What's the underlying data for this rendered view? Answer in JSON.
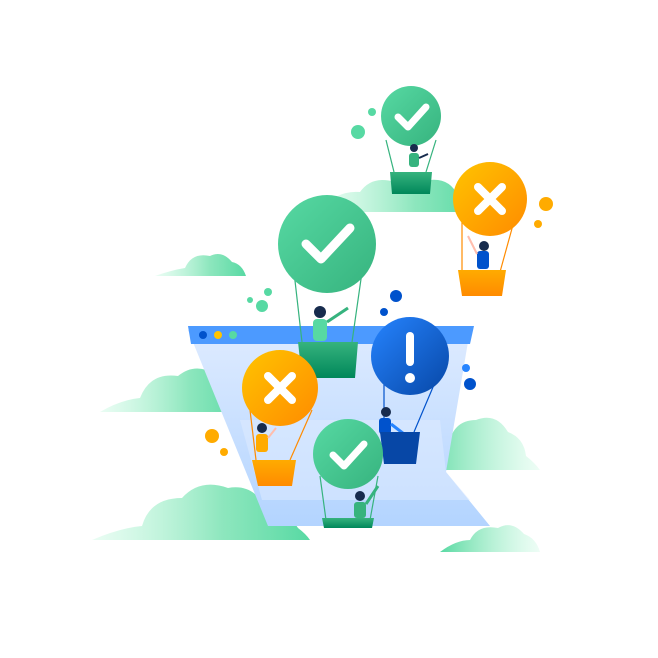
{
  "illustration": {
    "colors": {
      "green": "#36B37E",
      "green_light": "#79F2C0",
      "orange": "#FF8B00",
      "orange_light": "#FFC400",
      "blue": "#0052CC",
      "blue_mid": "#2684FF",
      "window_bg": "#DEEBFF",
      "cloud": "#ABF5D1"
    },
    "balloons": [
      {
        "status": "success",
        "icon": "checkmark-icon"
      },
      {
        "status": "error",
        "icon": "cross-icon"
      },
      {
        "status": "success",
        "icon": "checkmark-icon"
      },
      {
        "status": "warning",
        "icon": "exclamation-icon"
      },
      {
        "status": "error",
        "icon": "cross-icon"
      },
      {
        "status": "success",
        "icon": "checkmark-icon"
      }
    ]
  }
}
